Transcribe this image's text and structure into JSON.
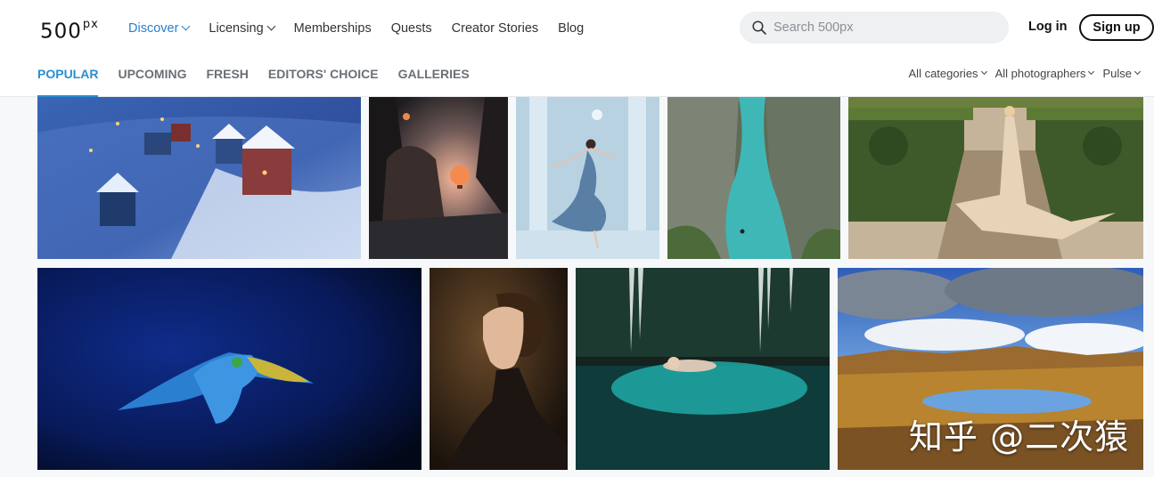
{
  "logo": {
    "text": "500",
    "sup": "px"
  },
  "nav": {
    "items": [
      {
        "label": "Discover",
        "dropdown": true,
        "active": true
      },
      {
        "label": "Licensing",
        "dropdown": true,
        "active": false
      },
      {
        "label": "Memberships",
        "dropdown": false,
        "active": false
      },
      {
        "label": "Quests",
        "dropdown": false,
        "active": false
      },
      {
        "label": "Creator Stories",
        "dropdown": false,
        "active": false
      },
      {
        "label": "Blog",
        "dropdown": false,
        "active": false
      }
    ]
  },
  "search": {
    "placeholder": "Search 500px",
    "value": ""
  },
  "auth": {
    "login_label": "Log in",
    "signup_label": "Sign up"
  },
  "tabs": [
    {
      "label": "POPULAR",
      "active": true
    },
    {
      "label": "UPCOMING",
      "active": false
    },
    {
      "label": "FRESH",
      "active": false
    },
    {
      "label": "EDITORS' CHOICE",
      "active": false
    },
    {
      "label": "GALLERIES",
      "active": false
    }
  ],
  "filters": [
    {
      "label": "All categories"
    },
    {
      "label": "All photographers"
    },
    {
      "label": "Pulse"
    }
  ],
  "colors": {
    "accent": "#2a8ed1",
    "nav_active": "#2a7ed1"
  },
  "photos": [
    {
      "subject": "snowy-village-at-dusk"
    },
    {
      "subject": "hot-air-balloon-between-rocks"
    },
    {
      "subject": "dancer-in-blue-dress"
    },
    {
      "subject": "turquoise-river-canyon"
    },
    {
      "subject": "woman-in-hedge-maze"
    },
    {
      "subject": "blue-macaw-in-flight"
    },
    {
      "subject": "woman-profile-portrait"
    },
    {
      "subject": "woman-floating-in-cave-water"
    },
    {
      "subject": "mountain-lake-under-clouds"
    }
  ],
  "watermark": "知乎 @二次猿"
}
